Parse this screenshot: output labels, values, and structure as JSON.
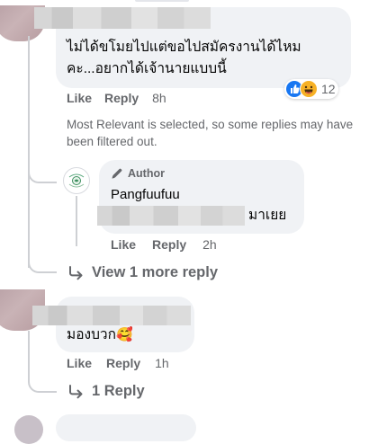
{
  "comment1": {
    "text_line1": "ไม่ได้ขโมยไปแต่ขอไปสมัครงานได้ไหม",
    "text_line2": "คะ...อยากได้เจ้านายแบบนี้",
    "like": "Like",
    "reply": "Reply",
    "time": "8h",
    "reaction_count": "12",
    "reaction_icons": [
      "like-icon",
      "haha-icon"
    ],
    "filter_notice": "Most Relevant is selected, so some replies may have been filtered out.",
    "colors": {
      "like_blue": "#1877f2",
      "haha_yellow": "#f7b125"
    }
  },
  "author_reply": {
    "badge": "Author",
    "badge_icon": "pencil-icon",
    "name": "Pangfuufuu",
    "text_suffix": "มาเยย",
    "like": "Like",
    "reply": "Reply",
    "time": "2h"
  },
  "view_more": {
    "label": "View 1 more reply",
    "icon": "reply-arrow-icon"
  },
  "comment2": {
    "text": "มองบวก",
    "emoji": "🥰",
    "like": "Like",
    "reply": "Reply",
    "time": "1h"
  },
  "replies_link": {
    "label": "1 Reply",
    "icon": "reply-arrow-icon"
  }
}
